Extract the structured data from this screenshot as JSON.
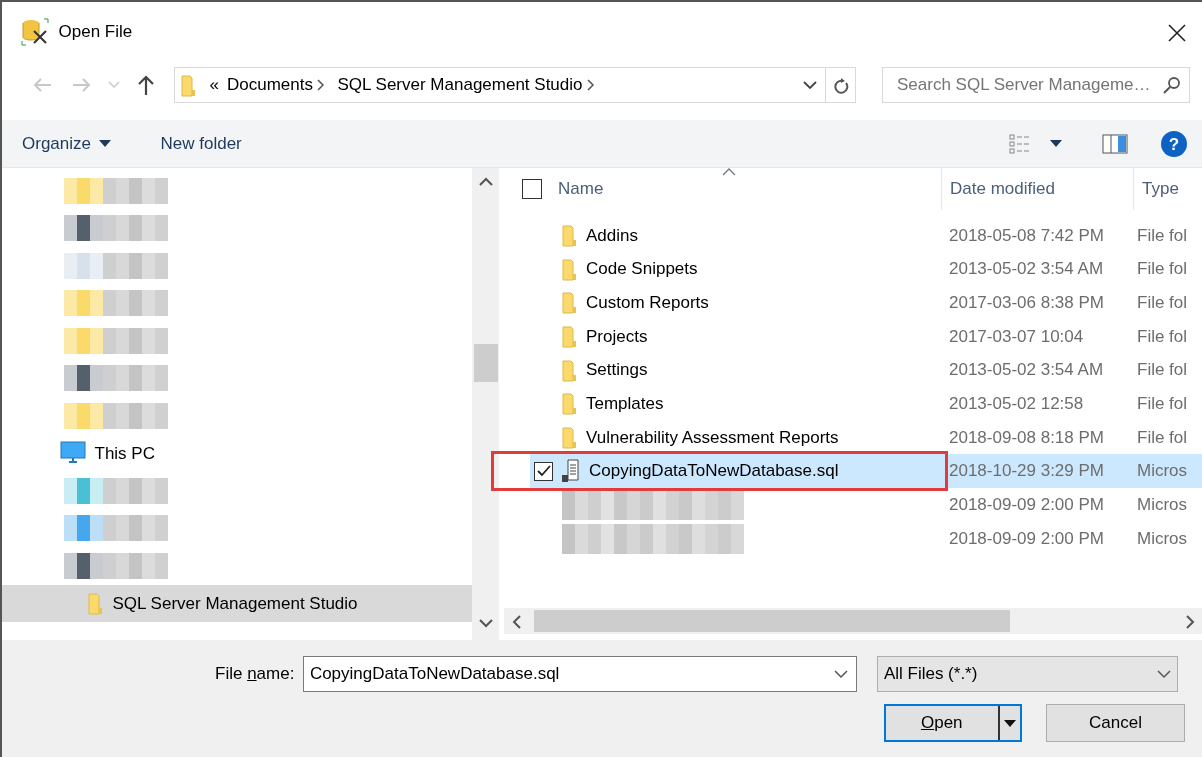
{
  "window": {
    "title": "Open File"
  },
  "nav": {
    "back_disabled": true,
    "forward_disabled": true
  },
  "address": {
    "overflow": "«",
    "crumbs": [
      "Documents",
      "SQL Server Management Studio"
    ]
  },
  "search": {
    "placeholder": "Search SQL Server Manageme…"
  },
  "toolbar": {
    "organize": "Organize",
    "new_folder": "New folder",
    "help": "?"
  },
  "tree": [
    {
      "kind": "redacted"
    },
    {
      "kind": "redacted"
    },
    {
      "kind": "redacted"
    },
    {
      "kind": "redacted"
    },
    {
      "kind": "redacted"
    },
    {
      "kind": "redacted"
    },
    {
      "kind": "redacted"
    },
    {
      "kind": "pc",
      "label": "This PC",
      "selected": false,
      "children": [
        {
          "kind": "redacted"
        },
        {
          "kind": "redacted"
        },
        {
          "kind": "redacted"
        },
        {
          "kind": "folder",
          "label": "SQL Server Management Studio",
          "selected": true
        }
      ]
    }
  ],
  "table": {
    "columns": [
      "Name",
      "Date modified",
      "Type"
    ],
    "select_all_checked": false,
    "rows": [
      {
        "kind": "folder",
        "name": "Addins",
        "date": "2018-05-08 7:42 PM",
        "type": "File fol",
        "selected": false,
        "checked": false
      },
      {
        "kind": "folder",
        "name": "Code Snippets",
        "date": "2013-05-02 3:54 AM",
        "type": "File fol",
        "selected": false,
        "checked": false
      },
      {
        "kind": "folder",
        "name": "Custom Reports",
        "date": "2017-03-06 8:38 PM",
        "type": "File fol",
        "selected": false,
        "checked": false
      },
      {
        "kind": "folder",
        "name": "Projects",
        "date": "2017-03-07 10:04",
        "type": "File fol",
        "selected": false,
        "checked": false
      },
      {
        "kind": "folder",
        "name": "Settings",
        "date": "2013-05-02 3:54 AM",
        "type": "File fol",
        "selected": false,
        "checked": false
      },
      {
        "kind": "folder",
        "name": "Templates",
        "date": "2013-05-02 12:58",
        "type": "File fol",
        "selected": false,
        "checked": false
      },
      {
        "kind": "folder",
        "name": "Vulnerability Assessment Reports",
        "date": "2018-09-08 8:18 PM",
        "type": "File fol",
        "selected": false,
        "checked": false
      },
      {
        "kind": "file",
        "name": "CopyingDataToNewDatabase.sql",
        "date": "2018-10-29 3:29 PM",
        "type": "Micros",
        "selected": true,
        "checked": true,
        "highlight": true
      },
      {
        "kind": "redacted",
        "date": "2018-09-09 2:00 PM",
        "type": "Micros",
        "selected": false,
        "checked": false
      },
      {
        "kind": "redacted",
        "date": "2018-09-09 2:00 PM",
        "type": "Micros",
        "selected": false,
        "checked": false
      }
    ]
  },
  "footer": {
    "filename_label": {
      "before": "File ",
      "key": "n",
      "after": "ame:"
    },
    "filename": "CopyingDataToNewDatabase.sql",
    "filter": "All Files (*.*)",
    "open": {
      "key": "O",
      "after": "pen"
    },
    "cancel": "Cancel"
  }
}
